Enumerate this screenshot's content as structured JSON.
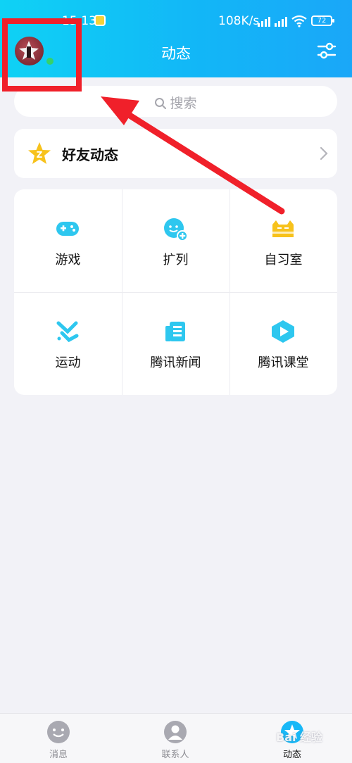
{
  "status_bar": {
    "time": "15:13",
    "network_speed": "108K/s",
    "battery": "72"
  },
  "header": {
    "title": "动态"
  },
  "search": {
    "placeholder": "搜索"
  },
  "friends_feed": {
    "label": "好友动态"
  },
  "grid": {
    "items": [
      {
        "label": "游戏",
        "icon": "gamepad-icon"
      },
      {
        "label": "扩列",
        "icon": "chat-face-plus-icon"
      },
      {
        "label": "自习室",
        "icon": "cat-icon"
      },
      {
        "label": "运动",
        "icon": "running-icon"
      },
      {
        "label": "腾讯新闻",
        "icon": "news-icon"
      },
      {
        "label": "腾讯课堂",
        "icon": "play-classroom-icon"
      }
    ]
  },
  "tabbar": {
    "tabs": [
      {
        "label": "消息",
        "icon": "message-face-icon"
      },
      {
        "label": "联系人",
        "icon": "contacts-icon"
      },
      {
        "label": "动态",
        "icon": "feed-star-icon",
        "active": true
      }
    ]
  },
  "watermark": "Bai 经验",
  "colors": {
    "header_start": "#0fd2f5",
    "header_end": "#1aa7f8",
    "accent_cyan": "#1ec6ee",
    "accent_yellow": "#f7c21c",
    "annotation_red": "#f0202a",
    "background": "#f2f2f7"
  }
}
